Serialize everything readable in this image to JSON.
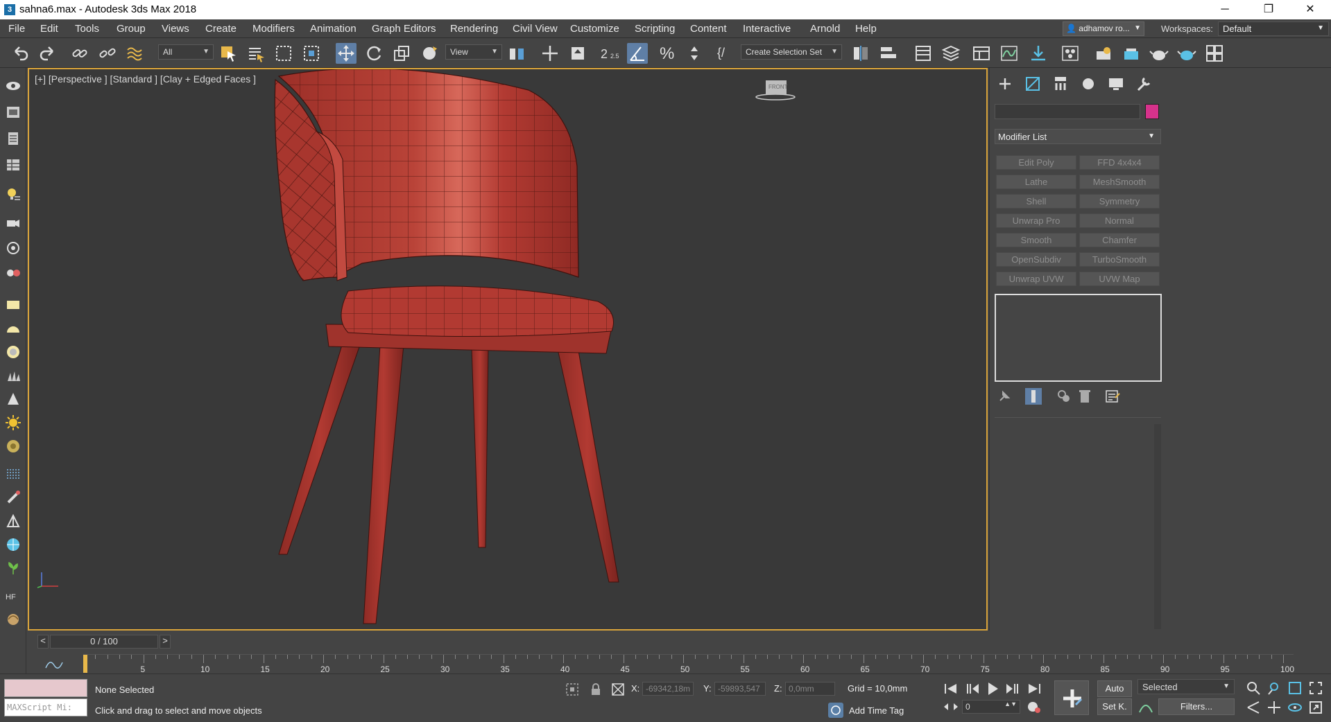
{
  "window": {
    "title": "sahna6.max - Autodesk 3ds Max 2018",
    "app_icon_glyph": "3",
    "minimize_glyph": "─",
    "maximize_glyph": "❐",
    "close_glyph": "✕"
  },
  "menu": [
    "File",
    "Edit",
    "Tools",
    "Group",
    "Views",
    "Create",
    "Modifiers",
    "Animation",
    "Graph Editors",
    "Rendering",
    "Civil View",
    "Customize",
    "Scripting",
    "Content",
    "Interactive",
    "Arnold",
    "Help"
  ],
  "user": {
    "name": "adhamov ro..."
  },
  "workspaces": {
    "label": "Workspaces:",
    "value": "Default"
  },
  "toolbar": {
    "filter_value": "All",
    "refcoord_value": "View",
    "selection_set": "Create Selection Set",
    "snap_label": "2.5",
    "percent_glyph": "%",
    "brace_glyph": "{/"
  },
  "viewport": {
    "label": "[+] [Perspective ] [Standard ] [Clay + Edged Faces ]",
    "viewcube_label": "FRONT",
    "model_color": "#b23a32"
  },
  "command_panel": {
    "modifier_list": "Modifier List",
    "swatch_color": "#d6328b",
    "modifiers": [
      [
        "Edit Poly",
        "FFD 4x4x4"
      ],
      [
        "Lathe",
        "MeshSmooth"
      ],
      [
        "Shell",
        "Symmetry"
      ],
      [
        "Unwrap Pro",
        "Normal"
      ],
      [
        "Smooth",
        "Chamfer"
      ],
      [
        "OpenSubdiv",
        "TurboSmooth"
      ],
      [
        "Unwrap UVW",
        "UVW Map"
      ]
    ]
  },
  "timeline": {
    "slider": "0 / 100",
    "prev": "<",
    "next": ">",
    "ticks": [
      "5",
      "10",
      "15",
      "20",
      "25",
      "30",
      "35",
      "40",
      "45",
      "50",
      "55",
      "60",
      "65",
      "70",
      "75",
      "80",
      "85",
      "90",
      "95",
      "100"
    ]
  },
  "status": {
    "maxscript": "MAXScript Mi:",
    "selection": "None Selected",
    "prompt": "Click and drag to select and move objects",
    "x_label": "X:",
    "x_value": "-69342,18m",
    "y_label": "Y:",
    "y_value": "-59893,547",
    "z_label": "Z:",
    "z_value": "0,0mm",
    "grid": "Grid = 10,0mm",
    "add_time_tag": "Add Time Tag",
    "auto": "Auto",
    "set_key": "Set K.",
    "selected": "Selected",
    "filters": "Filters...",
    "frame": "0"
  }
}
